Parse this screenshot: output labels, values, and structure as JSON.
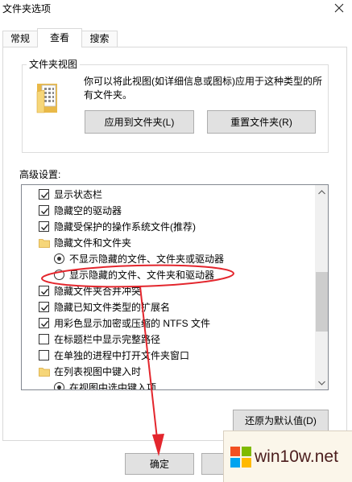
{
  "window": {
    "title": "文件夹选项"
  },
  "tabs": [
    {
      "label": "常规",
      "selected": false
    },
    {
      "label": "查看",
      "selected": true
    },
    {
      "label": "搜索",
      "selected": false
    }
  ],
  "folder_views": {
    "group_label": "文件夹视图",
    "description": "你可以将此视图(如详细信息或图标)应用于这种类型的所有文件夹。",
    "apply_button": "应用到文件夹(L)",
    "reset_button": "重置文件夹(R)"
  },
  "advanced": {
    "label": "高级设置:",
    "items": [
      {
        "type": "checkbox",
        "checked": true,
        "label": "显示状态栏"
      },
      {
        "type": "checkbox",
        "checked": true,
        "label": "隐藏空的驱动器"
      },
      {
        "type": "checkbox",
        "checked": true,
        "label": "隐藏受保护的操作系统文件(推荐)"
      },
      {
        "type": "folder",
        "checked": false,
        "label": "隐藏文件和文件夹"
      },
      {
        "type": "radio",
        "checked": true,
        "label": "不显示隐藏的文件、文件夹或驱动器"
      },
      {
        "type": "radio",
        "checked": false,
        "label": "显示隐藏的文件、文件夹和驱动器"
      },
      {
        "type": "checkbox",
        "checked": true,
        "label": "隐藏文件夹合并冲突"
      },
      {
        "type": "checkbox",
        "checked": true,
        "label": "隐藏已知文件类型的扩展名"
      },
      {
        "type": "checkbox",
        "checked": true,
        "label": "用彩色显示加密或压缩的 NTFS 文件"
      },
      {
        "type": "checkbox",
        "checked": false,
        "label": "在标题栏中显示完整路径"
      },
      {
        "type": "checkbox",
        "checked": false,
        "label": "在单独的进程中打开文件夹窗口"
      },
      {
        "type": "folder",
        "checked": false,
        "label": "在列表视图中键入时"
      },
      {
        "type": "radio",
        "checked": true,
        "label": "在视图中选中键入项"
      }
    ]
  },
  "restore_defaults_button": "还原为默认值(D)",
  "dialog_buttons": {
    "ok": "确定"
  },
  "watermark": {
    "text": "win10w.net"
  },
  "icons": {
    "close": "close-icon",
    "folder_view": "folder-view-icon",
    "tree_folder": "folder-icon",
    "scroll_up": "chevron-up-icon",
    "scroll_down": "chevron-down-icon",
    "watermark_logo": "windows-logo-icon"
  },
  "colors": {
    "annotation_red": "#E3262D",
    "button_face": "#E1E1E1",
    "button_border": "#ADADAD",
    "folder_yellow": "#F6D679",
    "watermark_text": "#4B1D1D",
    "logo_red": "#F25022",
    "logo_green": "#7FBA00",
    "logo_blue": "#00A4EF",
    "logo_yellow": "#FFB900"
  }
}
